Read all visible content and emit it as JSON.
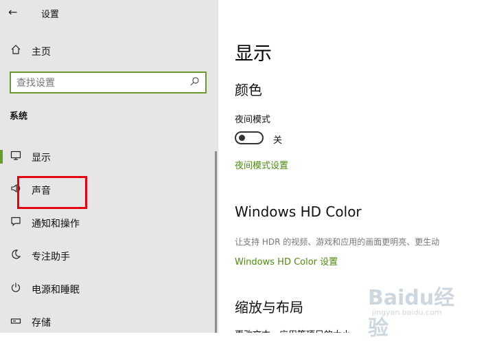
{
  "app": {
    "title": "设置",
    "back_icon": "back-arrow-icon"
  },
  "sidebar": {
    "home": {
      "label": "主页",
      "icon": "home-icon"
    },
    "search": {
      "placeholder": "查找设置",
      "icon": "search-icon"
    },
    "section": "系统",
    "items": [
      {
        "label": "显示",
        "icon": "monitor-icon",
        "active": true
      },
      {
        "label": "声音",
        "icon": "speaker-icon",
        "active": false
      },
      {
        "label": "通知和操作",
        "icon": "notification-icon",
        "active": false
      },
      {
        "label": "专注助手",
        "icon": "moon-icon",
        "active": false
      },
      {
        "label": "电源和睡眠",
        "icon": "power-icon",
        "active": false
      },
      {
        "label": "存储",
        "icon": "storage-icon",
        "active": false
      }
    ]
  },
  "main": {
    "title": "显示",
    "color_section": {
      "heading": "颜色",
      "night_mode_label": "夜间模式",
      "toggle_state": "关",
      "night_mode_link": "夜间模式设置"
    },
    "hd_section": {
      "heading": "Windows HD Color",
      "description": "让支持 HDR 的视频、游戏和应用的画面更明亮、更生动",
      "link": "Windows HD Color 设置"
    },
    "scale_section": {
      "heading": "缩放与布局",
      "cut_text": "更改文本、应用等项目的大小"
    }
  },
  "watermark": {
    "logo": "Baidu经验",
    "sub": "jingyan.baidu.com"
  },
  "colors": {
    "accent": "#6b9a2a",
    "link": "#4f8a10",
    "highlight": "#e60012",
    "sidebar_bg": "#e6e6e6"
  }
}
